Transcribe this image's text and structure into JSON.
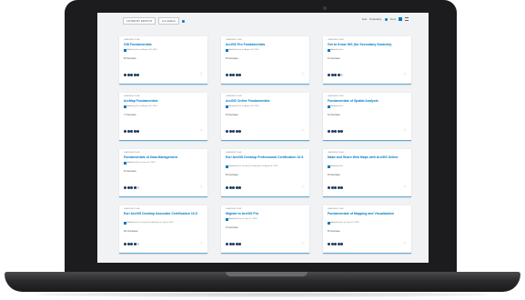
{
  "toolbar": {
    "filter_label": "FILTER BY EDITION",
    "filter_value": "Any Edition",
    "sort_label": "Sort",
    "sort_value": "Popularity",
    "view_label": "View"
  },
  "cards": [
    {
      "type": "LEARNING PLAN",
      "title": "GIS Fundamentals",
      "author": "Added by Esri on August 19, 2016",
      "count": "8 Courses",
      "rating": 5
    },
    {
      "type": "LEARNING PLAN",
      "title": "ArcGIS Pro Fundamentals",
      "author": "Added by Esri on August 19, 2016",
      "count": "8 Courses",
      "rating": 5
    },
    {
      "type": "LEARNING PLAN",
      "title": "Get to Know GIS (for Secondary Students)",
      "author": "Added by Esri",
      "count": "6 Courses",
      "rating": 4
    },
    {
      "type": "LEARNING PLAN",
      "title": "ArcMap Fundamentals",
      "author": "Added by Esri on August 19, 2016",
      "count": "7 Courses",
      "rating": 5
    },
    {
      "type": "LEARNING PLAN",
      "title": "ArcGIS Online Fundamentals",
      "author": "Added by Esri on August 19, 2016",
      "count": "9 Courses",
      "rating": 5
    },
    {
      "type": "LEARNING PLAN",
      "title": "Fundamentals of Spatial Analysis",
      "author": "Added by Esri",
      "count": "6 Courses",
      "rating": 5
    },
    {
      "type": "LEARNING PLAN",
      "title": "Fundamentals of Data Management",
      "author": "Added by Esri on June 15, 2016",
      "count": "6 Courses",
      "rating": 4
    },
    {
      "type": "LEARNING PLAN",
      "title": "Esri ArcGIS Desktop Professional Certification 10.5",
      "author": "Added by Esri Technical Certification on August 3, 2016",
      "count": "8 Courses",
      "rating": 5
    },
    {
      "type": "LEARNING PLAN",
      "title": "Make and Share Web Maps with ArcGIS Online",
      "author": "Added by Esri",
      "count": "6 Courses",
      "rating": 5
    },
    {
      "type": "LEARNING PLAN",
      "title": "Esri ArcGIS Desktop Associate Certification 10.5",
      "author": "Added by Esri Technical Certification on July 6, 2016",
      "count": "10 Courses",
      "rating": 4
    },
    {
      "type": "LEARNING PLAN",
      "title": "Migrate to ArcGIS Pro",
      "author": "Added by Esri on June 15, 2016",
      "count": "3 Courses",
      "rating": 5
    },
    {
      "type": "LEARNING PLAN",
      "title": "Fundamentals of Mapping and Visualization",
      "author": "Added by Esri on June 15, 2016",
      "count": "8 Courses",
      "rating": 5
    }
  ]
}
